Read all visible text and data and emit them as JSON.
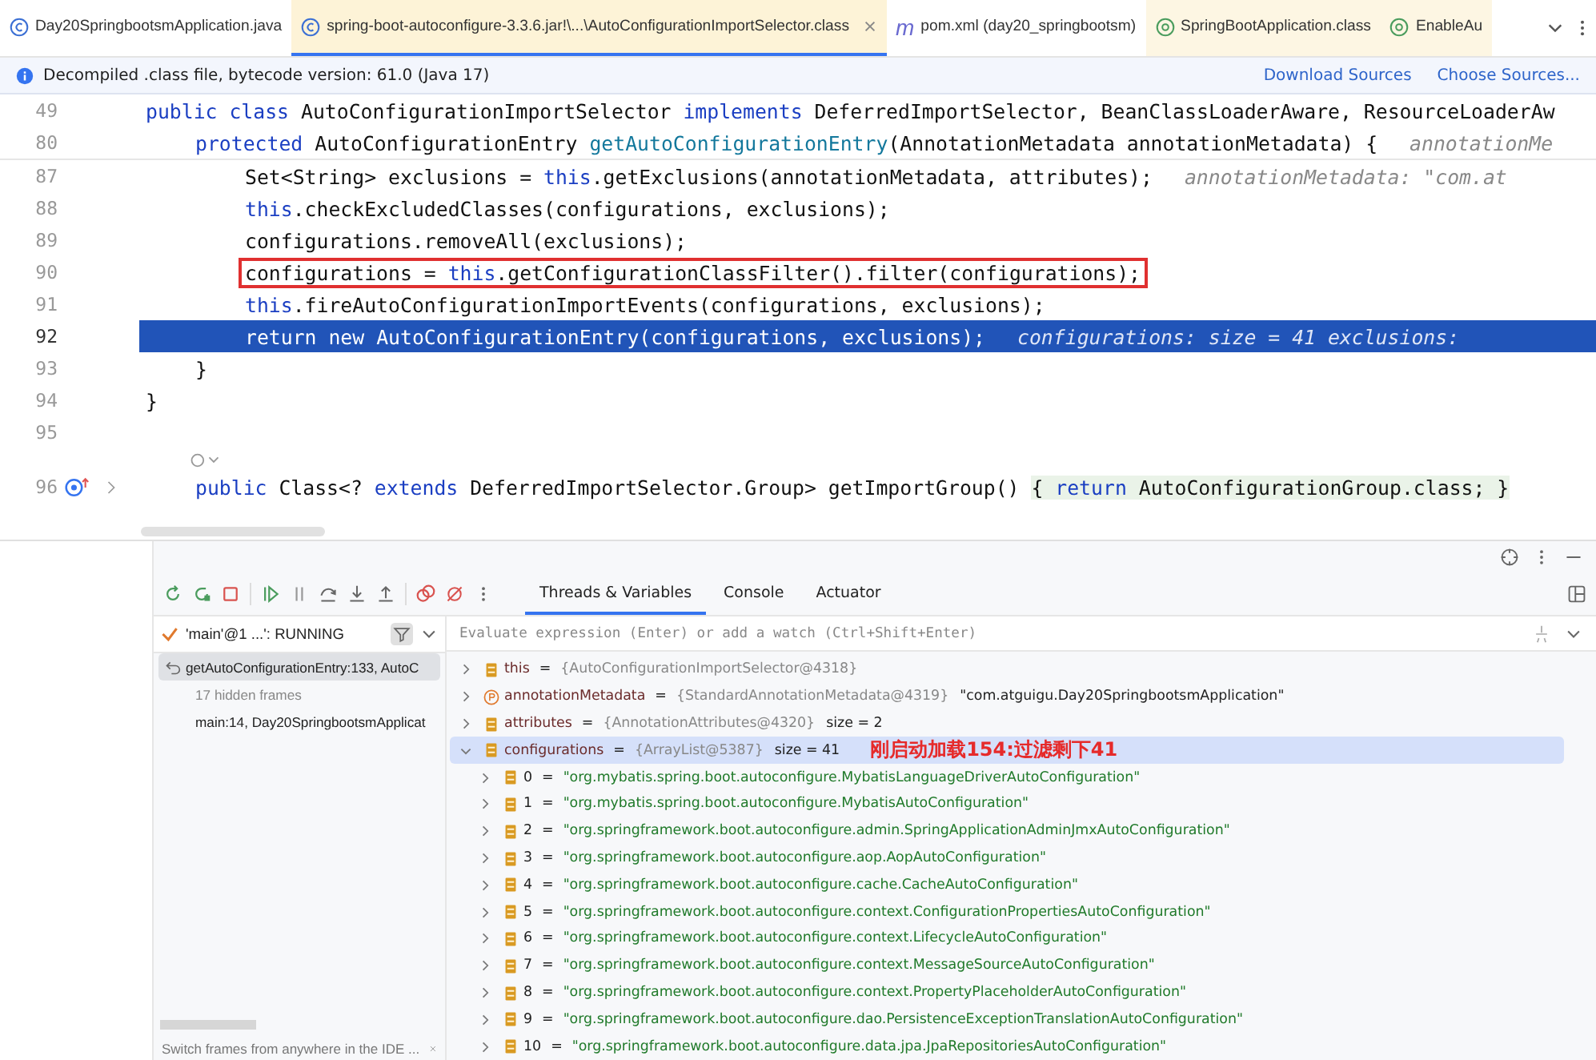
{
  "tabs": [
    {
      "label": "Day20SpringbootsmApplication.java",
      "kind": "class",
      "selected": false,
      "closable": false
    },
    {
      "label": "spring-boot-autoconfigure-3.3.6.jar!\\...\\AutoConfigurationImportSelector.class",
      "kind": "class",
      "selected": true,
      "closable": true
    },
    {
      "label": "pom.xml (day20_springbootsm)",
      "kind": "maven",
      "icon_text": "m",
      "selected": false,
      "closable": false
    },
    {
      "label": "SpringBootApplication.class",
      "kind": "annotation",
      "selected": false,
      "closable": false
    },
    {
      "label": "EnableAu",
      "kind": "annotation",
      "selected": false,
      "closable": false
    }
  ],
  "banner": {
    "text": "Decompiled .class file, bytecode version: 61.0 (Java 17)",
    "links": [
      "Download Sources",
      "Choose Sources..."
    ]
  },
  "editor": {
    "sticky_lines": [
      {
        "number": "49",
        "tokens": [
          {
            "t": "public class ",
            "kind": "keyword"
          },
          {
            "t": "AutoConfigurationImportSelector ",
            "kind": "plain"
          },
          {
            "t": "implements ",
            "kind": "keyword"
          },
          {
            "t": "DeferredImportSelector, BeanClassLoaderAware, ResourceLoaderAw",
            "kind": "plain"
          }
        ],
        "children": [
          {
            "number": "80",
            "tokens": [
              {
                "t": "protected ",
                "kind": "keyword"
              },
              {
                "t": "AutoConfigurationEntry ",
                "kind": "plain"
              },
              {
                "t": "getAutoConfigurationEntry",
                "kind": "declaration"
              },
              {
                "t": "(AnnotationMetadata annotationMetadata) {",
                "kind": "plain"
              }
            ],
            "hint": "annotationMe"
          }
        ]
      }
    ],
    "lines": [
      {
        "children": [
          {
            "children": [
              {
                "number": "87",
                "tokens": [
                  {
                    "t": "Set<String> exclusions = ",
                    "kind": "plain"
                  },
                  {
                    "t": "this",
                    "kind": "keyword"
                  },
                  {
                    "t": ".getExclusions(annotationMetadata, attributes);",
                    "kind": "plain"
                  }
                ],
                "hint": "annotationMetadata: \"com.at",
                "boxed": false,
                "current": false
              },
              {
                "number": "88",
                "tokens": [
                  {
                    "t": "this",
                    "kind": "keyword"
                  },
                  {
                    "t": ".checkExcludedClasses(configurations, exclusions);",
                    "kind": "plain"
                  }
                ],
                "boxed": false,
                "current": false
              },
              {
                "number": "89",
                "tokens": [
                  {
                    "t": "configurations.removeAll(exclusions);",
                    "kind": "plain"
                  }
                ],
                "boxed": false,
                "current": false
              },
              {
                "number": "90",
                "tokens": [
                  {
                    "t": "configurations = ",
                    "kind": "plain"
                  },
                  {
                    "t": "this",
                    "kind": "keyword"
                  },
                  {
                    "t": ".getConfigurationClassFilter().filter(configurations);",
                    "kind": "plain"
                  }
                ],
                "boxed": true,
                "current": false
              },
              {
                "number": "91",
                "tokens": [
                  {
                    "t": "this",
                    "kind": "keyword"
                  },
                  {
                    "t": ".fireAutoConfigurationImportEvents(configurations, exclusions);",
                    "kind": "plain"
                  }
                ],
                "boxed": false,
                "current": false
              },
              {
                "number": "92",
                "tokens": [
                  {
                    "t": "return new ",
                    "kind": "keyword"
                  },
                  {
                    "t": "AutoConfigurationEntry(configurations, exclusions);",
                    "kind": "plain"
                  }
                ],
                "hint": "configurations:  size = 41    exclusions:",
                "boxed": false,
                "current": true
              }
            ]
          },
          {
            "number": "93",
            "tokens": [
              {
                "t": "}",
                "kind": "plain"
              }
            ],
            "boxed": false,
            "current": false
          }
        ]
      },
      {
        "number": "94",
        "tokens": [
          {
            "t": "}",
            "kind": "plain"
          }
        ],
        "boxed": false,
        "current": false
      },
      {
        "number": "95",
        "current": false
      },
      {
        "children": [
          {
            "number": "96",
            "tokens": [
              {
                "t": "public ",
                "kind": "keyword"
              },
              {
                "t": "Class<? ",
                "kind": "plain"
              },
              {
                "t": "extends ",
                "kind": "keyword"
              },
              {
                "t": "DeferredImportSelector.Group> getImportGroup() ",
                "kind": "plain"
              },
              {
                "t": "{ ",
                "kind": "folded"
              },
              {
                "t": "return ",
                "kind": "folded-keyword"
              },
              {
                "t": "AutoConfigurationGroup.class; }",
                "kind": "folded"
              }
            ],
            "boxed": false,
            "current": false,
            "override_marker": true,
            "inlay_above": true
          }
        ]
      }
    ]
  },
  "debugger": {
    "tabs": [
      {
        "label": "Threads & Variables",
        "selected": true
      },
      {
        "label": "Console",
        "selected": false
      },
      {
        "label": "Actuator",
        "selected": false
      }
    ],
    "thread": "'main'@1 ...': RUNNING",
    "frames": [
      {
        "label": "getAutoConfigurationEntry:133, AutoC",
        "kind": "frame",
        "selected": true
      },
      {
        "label": "17 hidden frames",
        "kind": "hidden",
        "selected": false
      },
      {
        "label": "main:14, Day20SpringbootsmApplicat",
        "kind": "frame",
        "selected": false
      }
    ],
    "frames_hint": "Switch frames from anywhere in the IDE ...",
    "evaluate": {
      "placeholder": "Evaluate expression (Enter) or add a watch (Ctrl+Shift+Enter)"
    },
    "variables": [
      {
        "name": "this",
        "operator": "=",
        "kind": "field",
        "type": "{AutoConfigurationImportSelector@4318}",
        "expanded": false,
        "selected": false
      },
      {
        "name": "annotationMetadata",
        "operator": "=",
        "kind": "param",
        "type": "{StandardAnnotationMetadata@4319}",
        "value": "\"com.atguigu.Day20SpringbootsmApplication\"",
        "expanded": false,
        "selected": false
      },
      {
        "name": "attributes",
        "operator": "=",
        "kind": "field",
        "type": "{AnnotationAttributes@4320}",
        "value": "size = 2",
        "expanded": false,
        "selected": false
      },
      {
        "name": "configurations",
        "operator": "=",
        "kind": "field",
        "type": "{ArrayList@5387}",
        "value": "size = 41",
        "expanded": true,
        "selected": true,
        "annotation": "刚启动加载154:过滤剩下41",
        "children": [
          {
            "name": "0",
            "operator": "=",
            "value": "\"org.mybatis.spring.boot.autoconfigure.MybatisLanguageDriverAutoConfiguration\""
          },
          {
            "name": "1",
            "operator": "=",
            "value": "\"org.mybatis.spring.boot.autoconfigure.MybatisAutoConfiguration\""
          },
          {
            "name": "2",
            "operator": "=",
            "value": "\"org.springframework.boot.autoconfigure.admin.SpringApplicationAdminJmxAutoConfiguration\""
          },
          {
            "name": "3",
            "operator": "=",
            "value": "\"org.springframework.boot.autoconfigure.aop.AopAutoConfiguration\""
          },
          {
            "name": "4",
            "operator": "=",
            "value": "\"org.springframework.boot.autoconfigure.cache.CacheAutoConfiguration\""
          },
          {
            "name": "5",
            "operator": "=",
            "value": "\"org.springframework.boot.autoconfigure.context.ConfigurationPropertiesAutoConfiguration\""
          },
          {
            "name": "6",
            "operator": "=",
            "value": "\"org.springframework.boot.autoconfigure.context.LifecycleAutoConfiguration\""
          },
          {
            "name": "7",
            "operator": "=",
            "value": "\"org.springframework.boot.autoconfigure.context.MessageSourceAutoConfiguration\""
          },
          {
            "name": "8",
            "operator": "=",
            "value": "\"org.springframework.boot.autoconfigure.context.PropertyPlaceholderAutoConfiguration\""
          },
          {
            "name": "9",
            "operator": "=",
            "value": "\"org.springframework.boot.autoconfigure.dao.PersistenceExceptionTranslationAutoConfiguration\""
          },
          {
            "name": "10",
            "operator": "=",
            "value": "\"org.springframework.boot.autoconfigure.data.jpa.JpaRepositoriesAutoConfiguration\""
          }
        ]
      }
    ]
  }
}
